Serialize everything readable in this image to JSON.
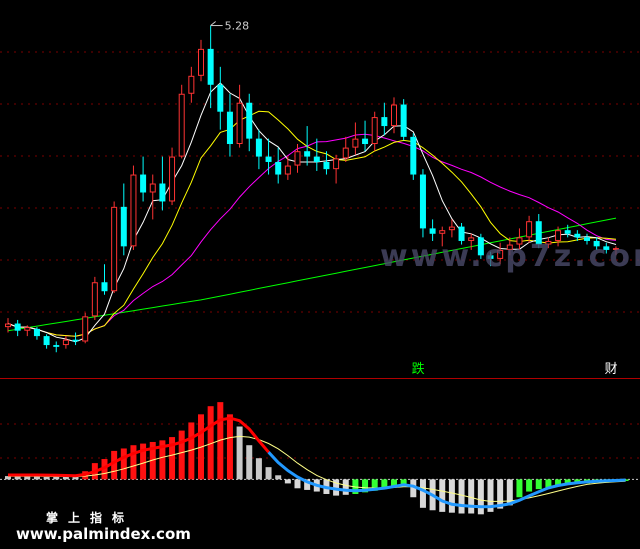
{
  "chart_data": [
    {
      "type": "candlestick",
      "price_peak_label": "5.28",
      "watermark": "www.cp7z.com",
      "markers": [
        {
          "text": "跌",
          "index": 41,
          "color": "#00ff00"
        },
        {
          "text": "财",
          "index": 61,
          "color": "#ffffff"
        }
      ],
      "series_colors": {
        "up": "#ff3333",
        "down": "#00ffff",
        "ma5": "#ffffff",
        "ma10": "#ffff00",
        "ma20": "#ff00ff",
        "ma60": "#00ff00"
      },
      "candles": [
        [
          3.6,
          3.65,
          3.57,
          3.62
        ],
        [
          3.62,
          3.64,
          3.55,
          3.58
        ],
        [
          3.58,
          3.61,
          3.55,
          3.6
        ],
        [
          3.59,
          3.6,
          3.53,
          3.55
        ],
        [
          3.55,
          3.56,
          3.48,
          3.5
        ],
        [
          3.5,
          3.52,
          3.46,
          3.49
        ],
        [
          3.5,
          3.55,
          3.48,
          3.53
        ],
        [
          3.53,
          3.57,
          3.5,
          3.52
        ],
        [
          3.52,
          3.68,
          3.51,
          3.66
        ],
        [
          3.66,
          3.88,
          3.64,
          3.85
        ],
        [
          3.85,
          3.95,
          3.78,
          3.8
        ],
        [
          3.8,
          4.3,
          3.79,
          4.27
        ],
        [
          4.27,
          4.4,
          4.0,
          4.05
        ],
        [
          4.05,
          4.5,
          4.03,
          4.45
        ],
        [
          4.45,
          4.55,
          4.3,
          4.35
        ],
        [
          4.35,
          4.45,
          4.2,
          4.4
        ],
        [
          4.4,
          4.55,
          4.25,
          4.3
        ],
        [
          4.3,
          4.6,
          4.28,
          4.55
        ],
        [
          4.55,
          4.95,
          4.54,
          4.9
        ],
        [
          4.9,
          5.05,
          4.85,
          5.0
        ],
        [
          5.0,
          5.2,
          4.97,
          5.15
        ],
        [
          5.15,
          5.28,
          4.82,
          4.95
        ],
        [
          4.95,
          5.05,
          4.7,
          4.8
        ],
        [
          4.8,
          4.9,
          4.55,
          4.62
        ],
        [
          4.62,
          4.95,
          4.6,
          4.85
        ],
        [
          4.85,
          4.9,
          4.58,
          4.65
        ],
        [
          4.65,
          4.7,
          4.48,
          4.55
        ],
        [
          4.55,
          4.65,
          4.45,
          4.52
        ],
        [
          4.52,
          4.6,
          4.4,
          4.45
        ],
        [
          4.45,
          4.55,
          4.42,
          4.5
        ],
        [
          4.5,
          4.62,
          4.46,
          4.58
        ],
        [
          4.58,
          4.72,
          4.5,
          4.55
        ],
        [
          4.55,
          4.65,
          4.47,
          4.52
        ],
        [
          4.52,
          4.58,
          4.45,
          4.48
        ],
        [
          4.48,
          4.56,
          4.4,
          4.54
        ],
        [
          4.54,
          4.66,
          4.52,
          4.6
        ],
        [
          4.6,
          4.74,
          4.56,
          4.65
        ],
        [
          4.65,
          4.75,
          4.58,
          4.62
        ],
        [
          4.62,
          4.8,
          4.58,
          4.77
        ],
        [
          4.77,
          4.85,
          4.67,
          4.72
        ],
        [
          4.72,
          4.88,
          4.68,
          4.84
        ],
        [
          4.84,
          4.87,
          4.64,
          4.66
        ],
        [
          4.66,
          4.68,
          4.42,
          4.45
        ],
        [
          4.45,
          4.48,
          4.1,
          4.15
        ],
        [
          4.15,
          4.2,
          4.08,
          4.12
        ],
        [
          4.12,
          4.16,
          4.05,
          4.14
        ],
        [
          4.14,
          4.2,
          4.1,
          4.16
        ],
        [
          4.16,
          4.18,
          4.06,
          4.08
        ],
        [
          4.08,
          4.12,
          4.03,
          4.1
        ],
        [
          4.1,
          4.12,
          3.98,
          4.0
        ],
        [
          4.0,
          4.02,
          3.94,
          3.98
        ],
        [
          3.98,
          4.07,
          3.95,
          4.03
        ],
        [
          4.03,
          4.1,
          4.0,
          4.06
        ],
        [
          4.06,
          4.15,
          4.03,
          4.1
        ],
        [
          4.1,
          4.22,
          4.07,
          4.19
        ],
        [
          4.19,
          4.23,
          4.04,
          4.06
        ],
        [
          4.06,
          4.1,
          4.04,
          4.08
        ],
        [
          4.08,
          4.16,
          4.05,
          4.14
        ],
        [
          4.14,
          4.17,
          4.1,
          4.12
        ],
        [
          4.12,
          4.14,
          4.08,
          4.1
        ],
        [
          4.1,
          4.12,
          4.06,
          4.08
        ],
        [
          4.08,
          4.1,
          4.03,
          4.05
        ],
        [
          4.05,
          4.07,
          4.01,
          4.03
        ],
        [
          4.03,
          4.05,
          4.0,
          4.04
        ]
      ],
      "ylim": [
        3.35,
        5.4
      ]
    },
    {
      "type": "bar",
      "labels": [
        "掌",
        "上",
        "指",
        "标"
      ],
      "series_colors": {
        "red": "#ff1111",
        "green": "#33ff33",
        "gray": "#c8c8c8",
        "grayLow": "#d8d8d8",
        "line_fast": "#ff0000",
        "line_slow": "#ffff88",
        "line_main": "#2299ff"
      },
      "bars": [
        0.4,
        0.4,
        0.4,
        0.4,
        0.3,
        0.3,
        0.3,
        0.3,
        1.0,
        2.0,
        2.5,
        3.5,
        3.8,
        4.2,
        4.4,
        4.6,
        4.8,
        5.2,
        6.0,
        7.0,
        8.0,
        9.0,
        9.5,
        8.0,
        6.5,
        4.2,
        2.6,
        1.5,
        0.5,
        -0.5,
        -1.1,
        -1.3,
        -1.5,
        -1.8,
        -2.0,
        -1.9,
        -1.8,
        -1.6,
        -1.4,
        -1.2,
        -0.9,
        -0.6,
        -2.2,
        -3.5,
        -3.8,
        -4.0,
        -4.1,
        -4.2,
        -4.2,
        -4.3,
        -4.0,
        -3.6,
        -3.2,
        -2.2,
        -1.5,
        -1.2,
        -1.0,
        -0.8,
        -0.6,
        -0.5,
        -0.5,
        -0.4,
        -0.4,
        -0.3,
        -0.2
      ],
      "ylim": [
        -5.0,
        10.5
      ]
    }
  ],
  "footer": {
    "site": "www.palmindex.com"
  }
}
